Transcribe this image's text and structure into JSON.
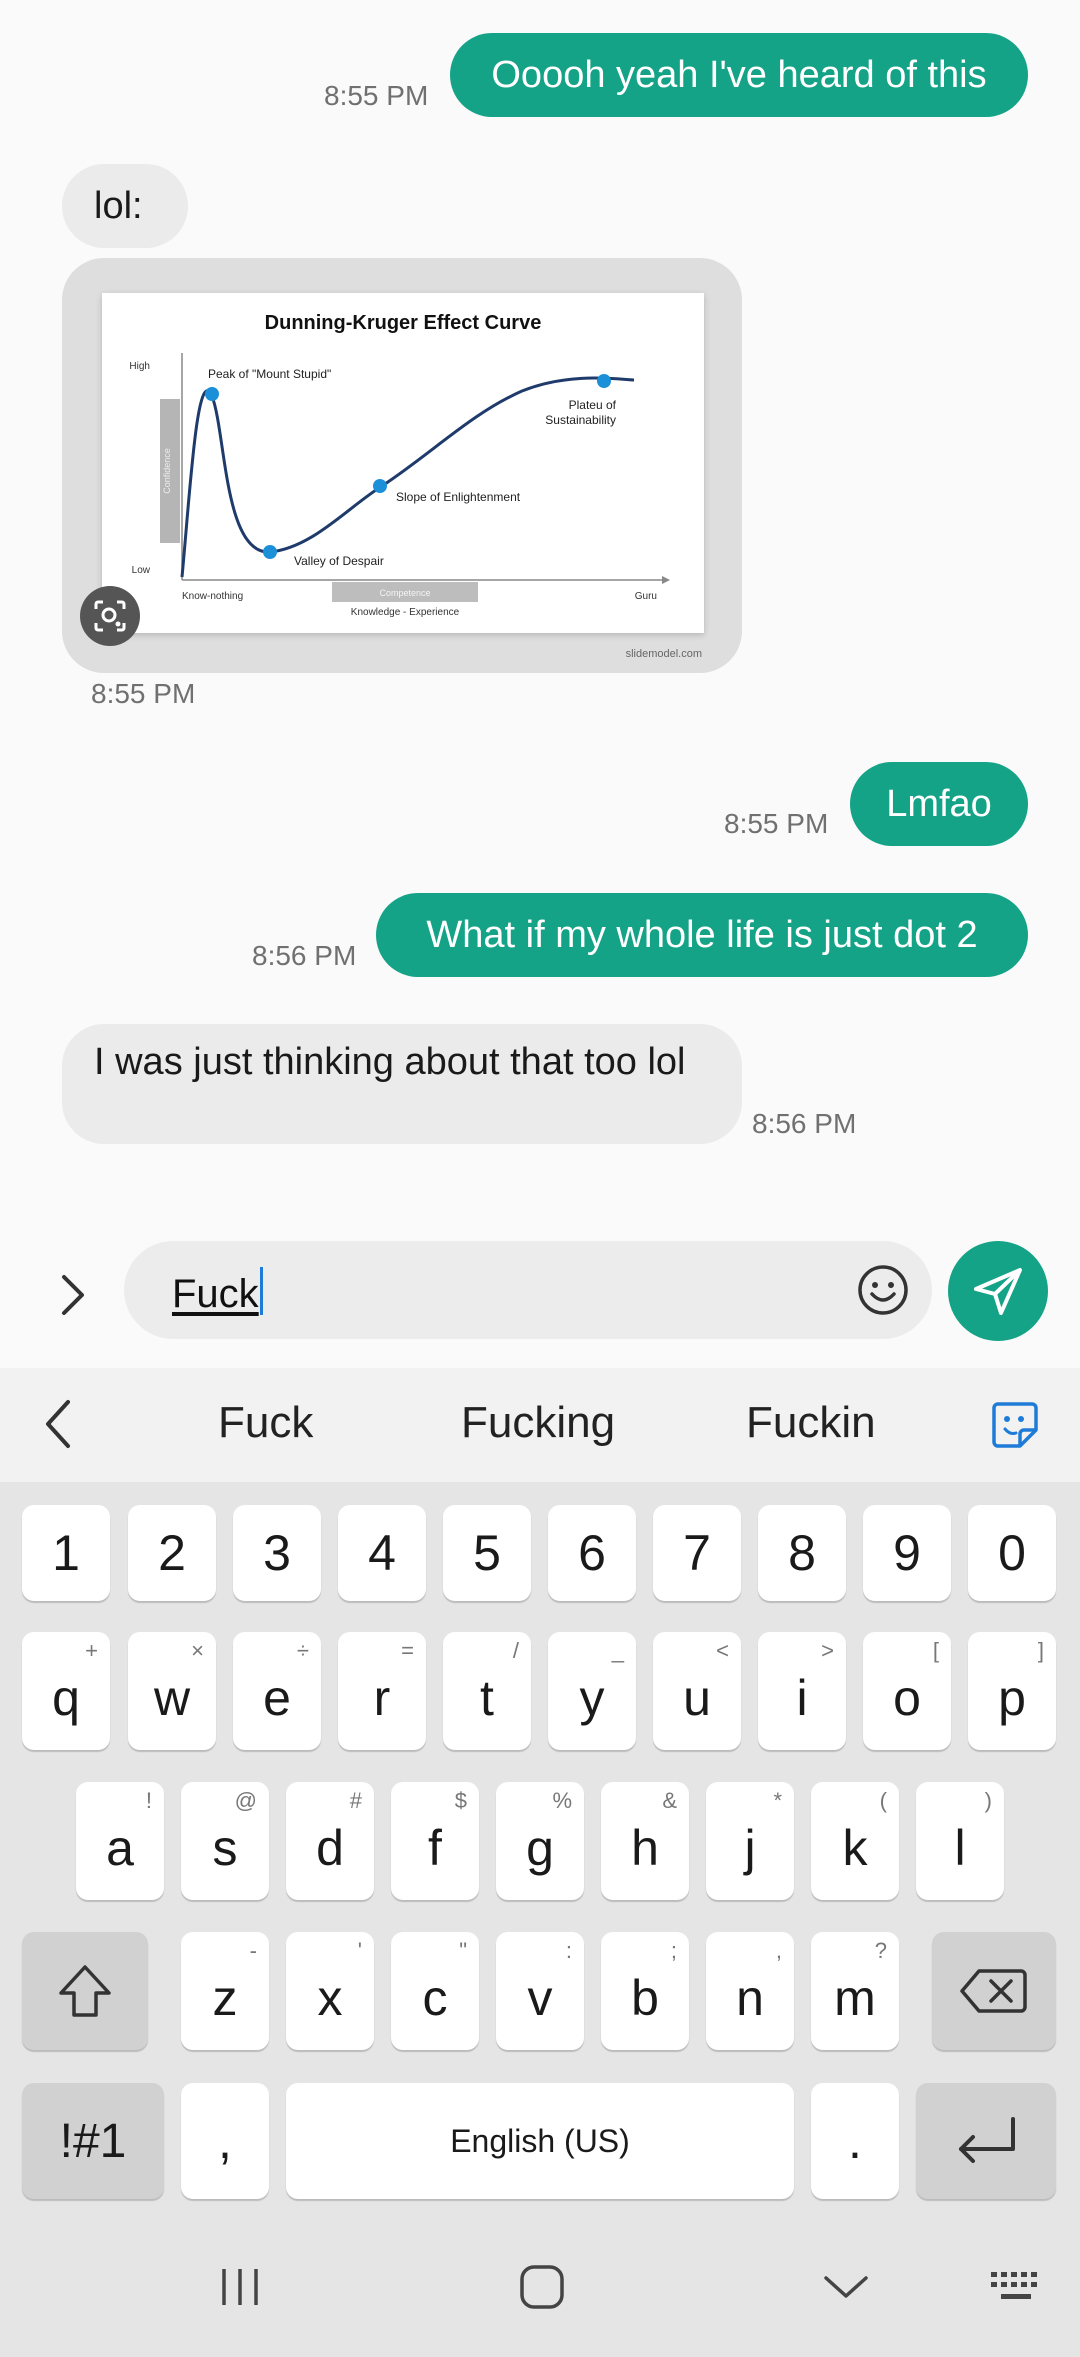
{
  "messages": [
    {
      "dir": "out",
      "text": "Ooooh yeah I've heard of this",
      "time": "8:55 PM"
    },
    {
      "dir": "in",
      "text": "lol:",
      "time": ""
    },
    {
      "dir": "in-image",
      "time": "8:55 PM"
    },
    {
      "dir": "out",
      "text": "Lmfao",
      "time": "8:55 PM"
    },
    {
      "dir": "out",
      "text": "What if my whole life is just dot 2",
      "time": "8:56 PM"
    },
    {
      "dir": "in",
      "text": "I was just thinking about that too lol",
      "time": "8:56 PM"
    }
  ],
  "image": {
    "title": "Dunning-Kruger Effect Curve",
    "y_high": "High",
    "y_low": "Low",
    "y_axis": "Confidence",
    "labels": {
      "peak": "Peak of \"Mount Stupid\"",
      "valley": "Valley of Despair",
      "slope": "Slope of Enlightenment",
      "plateau_1": "Plateu of",
      "plateau_2": "Sustainability"
    },
    "x_left": "Know-nothing",
    "x_right": "Guru",
    "x_band": "Competence",
    "x_axis": "Knowledge - Experience",
    "watermark": "slidemodel.com"
  },
  "compose": {
    "input_value": "Fuck"
  },
  "suggestions": [
    "Fuck",
    "Fucking",
    "Fuckin"
  ],
  "keyboard": {
    "numbers": [
      "1",
      "2",
      "3",
      "4",
      "5",
      "6",
      "7",
      "8",
      "9",
      "0"
    ],
    "row1": [
      {
        "k": "q",
        "s": "+"
      },
      {
        "k": "w",
        "s": "×"
      },
      {
        "k": "e",
        "s": "÷"
      },
      {
        "k": "r",
        "s": "="
      },
      {
        "k": "t",
        "s": "/"
      },
      {
        "k": "y",
        "s": "_"
      },
      {
        "k": "u",
        "s": "<"
      },
      {
        "k": "i",
        "s": ">"
      },
      {
        "k": "o",
        "s": "["
      },
      {
        "k": "p",
        "s": "]"
      }
    ],
    "row2": [
      {
        "k": "a",
        "s": "!"
      },
      {
        "k": "s",
        "s": "@"
      },
      {
        "k": "d",
        "s": "#"
      },
      {
        "k": "f",
        "s": "$"
      },
      {
        "k": "g",
        "s": "%"
      },
      {
        "k": "h",
        "s": "&"
      },
      {
        "k": "j",
        "s": "*"
      },
      {
        "k": "k",
        "s": "("
      },
      {
        "k": "l",
        "s": ")"
      }
    ],
    "row3": [
      {
        "k": "z",
        "s": "-"
      },
      {
        "k": "x",
        "s": "'"
      },
      {
        "k": "c",
        "s": "\""
      },
      {
        "k": "v",
        "s": ":"
      },
      {
        "k": "b",
        "s": ";"
      },
      {
        "k": "n",
        "s": ","
      },
      {
        "k": "m",
        "s": "?"
      }
    ],
    "symbols_label": "!#1",
    "comma": ",",
    "space_label": "English (US)",
    "period": "."
  },
  "colors": {
    "accent": "#14a387",
    "incoming_bubble": "#ebebeb",
    "chart_line": "#1f3b6b",
    "chart_dot": "#1b8fd8"
  }
}
